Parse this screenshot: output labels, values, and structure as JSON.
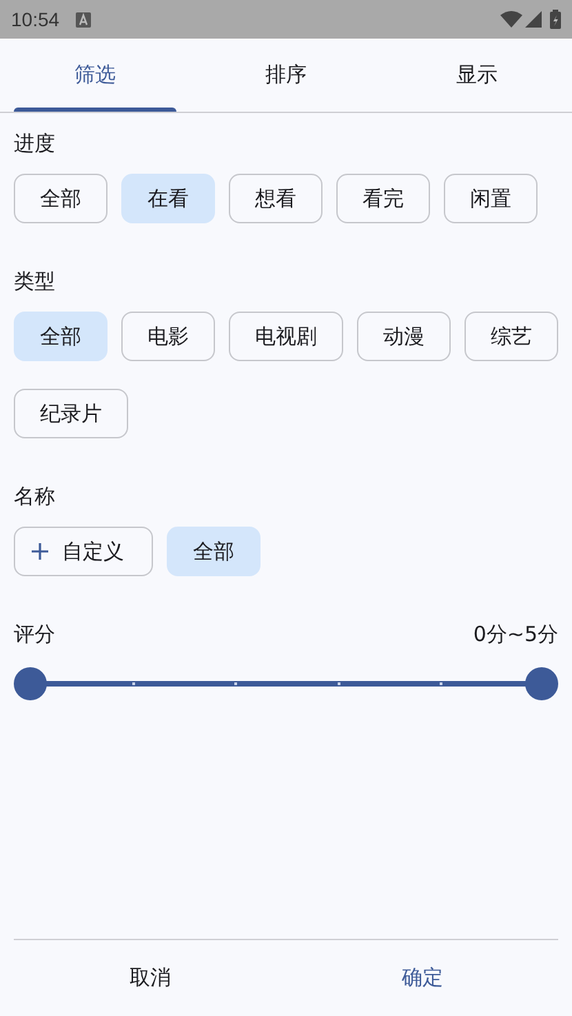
{
  "status_bar": {
    "time": "10:54"
  },
  "tabs": [
    {
      "label": "筛选",
      "selected": true
    },
    {
      "label": "排序",
      "selected": false
    },
    {
      "label": "显示",
      "selected": false
    }
  ],
  "sections": [
    {
      "title": "进度",
      "chips": [
        {
          "label": "全部",
          "selected": false
        },
        {
          "label": "在看",
          "selected": true
        },
        {
          "label": "想看",
          "selected": false
        },
        {
          "label": "看完",
          "selected": false
        },
        {
          "label": "闲置",
          "selected": false
        }
      ]
    },
    {
      "title": "类型",
      "chips": [
        {
          "label": "全部",
          "selected": true
        },
        {
          "label": "电影",
          "selected": false
        },
        {
          "label": "电视剧",
          "selected": false
        },
        {
          "label": "动漫",
          "selected": false
        },
        {
          "label": "综艺",
          "selected": false
        },
        {
          "label": "纪录片",
          "selected": false
        }
      ]
    },
    {
      "title": "名称",
      "chips": [
        {
          "label": "自定义",
          "selected": false,
          "kind": "add"
        },
        {
          "label": "全部",
          "selected": true
        }
      ]
    }
  ],
  "rating": {
    "title": "评分",
    "reading": "0分~5分",
    "thumbs": [
      {
        "level": 0
      },
      {
        "level": 1
      }
    ]
  },
  "buttons": [
    {
      "label": "取消",
      "kind": "plain"
    },
    {
      "label": "确定",
      "kind": "primary"
    }
  ]
}
